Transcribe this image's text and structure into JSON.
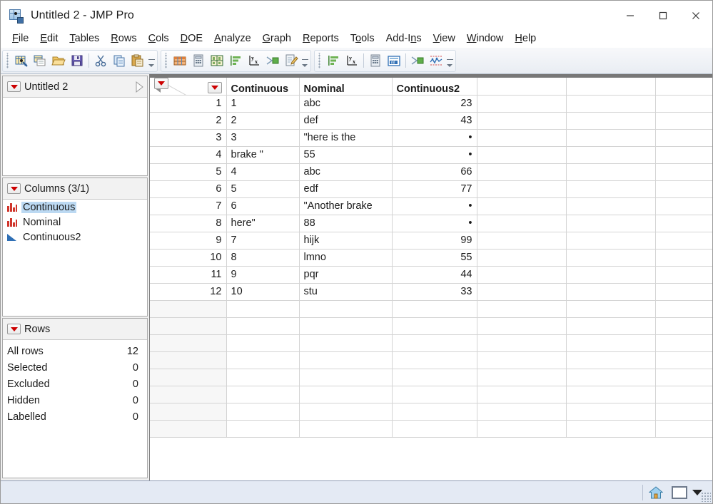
{
  "window": {
    "title": "Untitled 2 - JMP Pro",
    "app_icon": "jmp-data-table-icon",
    "minimize_label": "—",
    "maximize_label": "□",
    "close_label": "✕"
  },
  "menubar": {
    "items": [
      {
        "label": "File",
        "mnemonic": "F"
      },
      {
        "label": "Edit",
        "mnemonic": "E"
      },
      {
        "label": "Tables",
        "mnemonic": "T"
      },
      {
        "label": "Rows",
        "mnemonic": "R"
      },
      {
        "label": "Cols",
        "mnemonic": "C"
      },
      {
        "label": "DOE",
        "mnemonic": "D"
      },
      {
        "label": "Analyze",
        "mnemonic": "A"
      },
      {
        "label": "Graph",
        "mnemonic": "G"
      },
      {
        "label": "Reports",
        "mnemonic": "R"
      },
      {
        "label": "Tools",
        "mnemonic": "o"
      },
      {
        "label": "Add-Ins",
        "mnemonic": "n"
      },
      {
        "label": "View",
        "mnemonic": "V"
      },
      {
        "label": "Window",
        "mnemonic": "W"
      },
      {
        "label": "Help",
        "mnemonic": "H"
      }
    ]
  },
  "toolbar": {
    "groups": [
      {
        "name": "file-group",
        "buttons": [
          {
            "icon": "new-data-table-icon"
          },
          {
            "icon": "new-script-icon"
          },
          {
            "icon": "open-file-icon"
          },
          {
            "icon": "save-icon"
          },
          {
            "icon": "separator"
          },
          {
            "icon": "cut-icon"
          },
          {
            "icon": "copy-icon"
          },
          {
            "icon": "paste-icon"
          }
        ]
      },
      {
        "name": "analyze-group",
        "buttons": [
          {
            "icon": "data-table-icon"
          },
          {
            "icon": "calculator-icon"
          },
          {
            "icon": "subset-icon"
          },
          {
            "icon": "distribution-icon"
          },
          {
            "icon": "fit-y-by-x-icon"
          },
          {
            "icon": "fit-model-icon"
          },
          {
            "icon": "script-editor-icon"
          }
        ]
      },
      {
        "name": "graph-group",
        "buttons": [
          {
            "icon": "distribution-icon"
          },
          {
            "icon": "fit-y-by-x-icon"
          },
          {
            "icon": "separator"
          },
          {
            "icon": "calculator-icon"
          },
          {
            "icon": "graph-builder-icon"
          },
          {
            "icon": "separator"
          },
          {
            "icon": "fit-model-icon"
          },
          {
            "icon": "control-chart-icon"
          }
        ]
      }
    ]
  },
  "sidebar": {
    "table_panel": {
      "title": "Untitled 2",
      "menu_icon": "red-triangle-menu-icon",
      "collapse_icon": "collapse-triangle-icon"
    },
    "columns_panel": {
      "title": "Columns (3/1)",
      "menu_icon": "red-triangle-menu-icon",
      "items": [
        {
          "label": "Continuous",
          "type_icon": "nominal-bars-icon",
          "selected": true
        },
        {
          "label": "Nominal",
          "type_icon": "nominal-bars-icon",
          "selected": false
        },
        {
          "label": "Continuous2",
          "type_icon": "continuous-triangle-icon",
          "selected": false
        }
      ]
    },
    "rows_panel": {
      "title": "Rows",
      "menu_icon": "red-triangle-menu-icon",
      "stats": [
        {
          "label": "All rows",
          "value": "12"
        },
        {
          "label": "Selected",
          "value": "0"
        },
        {
          "label": "Excluded",
          "value": "0"
        },
        {
          "label": "Hidden",
          "value": "0"
        },
        {
          "label": "Labelled",
          "value": "0"
        }
      ]
    }
  },
  "table": {
    "corner": {
      "collapse_icon": "left-triangle-icon",
      "columns_menu_icon": "red-triangle-menu-icon",
      "rows_menu_icon": "red-triangle-menu-icon"
    },
    "columns": [
      {
        "name": "Continuous",
        "selected": true,
        "align": "left"
      },
      {
        "name": "Nominal",
        "selected": false,
        "align": "left"
      },
      {
        "name": "Continuous2",
        "selected": false,
        "align": "left"
      },
      {
        "name": "",
        "selected": false,
        "align": "left"
      },
      {
        "name": "",
        "selected": false,
        "align": "left"
      },
      {
        "name": "",
        "selected": false,
        "align": "left"
      }
    ],
    "missing_symbol": "•",
    "rows": [
      {
        "n": "1",
        "cells": [
          "1",
          "abc",
          "23"
        ]
      },
      {
        "n": "2",
        "cells": [
          "2",
          "def",
          "43"
        ]
      },
      {
        "n": "3",
        "cells": [
          "3",
          "\"here is the",
          "•"
        ]
      },
      {
        "n": "4",
        "cells": [
          "brake \"",
          "55",
          "•"
        ]
      },
      {
        "n": "5",
        "cells": [
          "4",
          "abc",
          "66"
        ]
      },
      {
        "n": "6",
        "cells": [
          "5",
          "edf",
          "77"
        ]
      },
      {
        "n": "7",
        "cells": [
          "6",
          "\"Another brake",
          "•"
        ]
      },
      {
        "n": "8",
        "cells": [
          "here\"",
          "88",
          "•"
        ]
      },
      {
        "n": "9",
        "cells": [
          "7",
          "hijk",
          "99"
        ]
      },
      {
        "n": "10",
        "cells": [
          "8",
          "lmno",
          "55"
        ]
      },
      {
        "n": "11",
        "cells": [
          "9",
          "pqr",
          "44"
        ]
      },
      {
        "n": "12",
        "cells": [
          "10",
          "stu",
          "33"
        ]
      }
    ],
    "empty_row_count": 8
  },
  "statusbar": {
    "home_icon": "home-icon",
    "panel_toggle_icon": "panel-square-icon",
    "dropdown_icon": "dropdown-arrow-icon",
    "resize_grip_icon": "resize-grip-icon"
  }
}
